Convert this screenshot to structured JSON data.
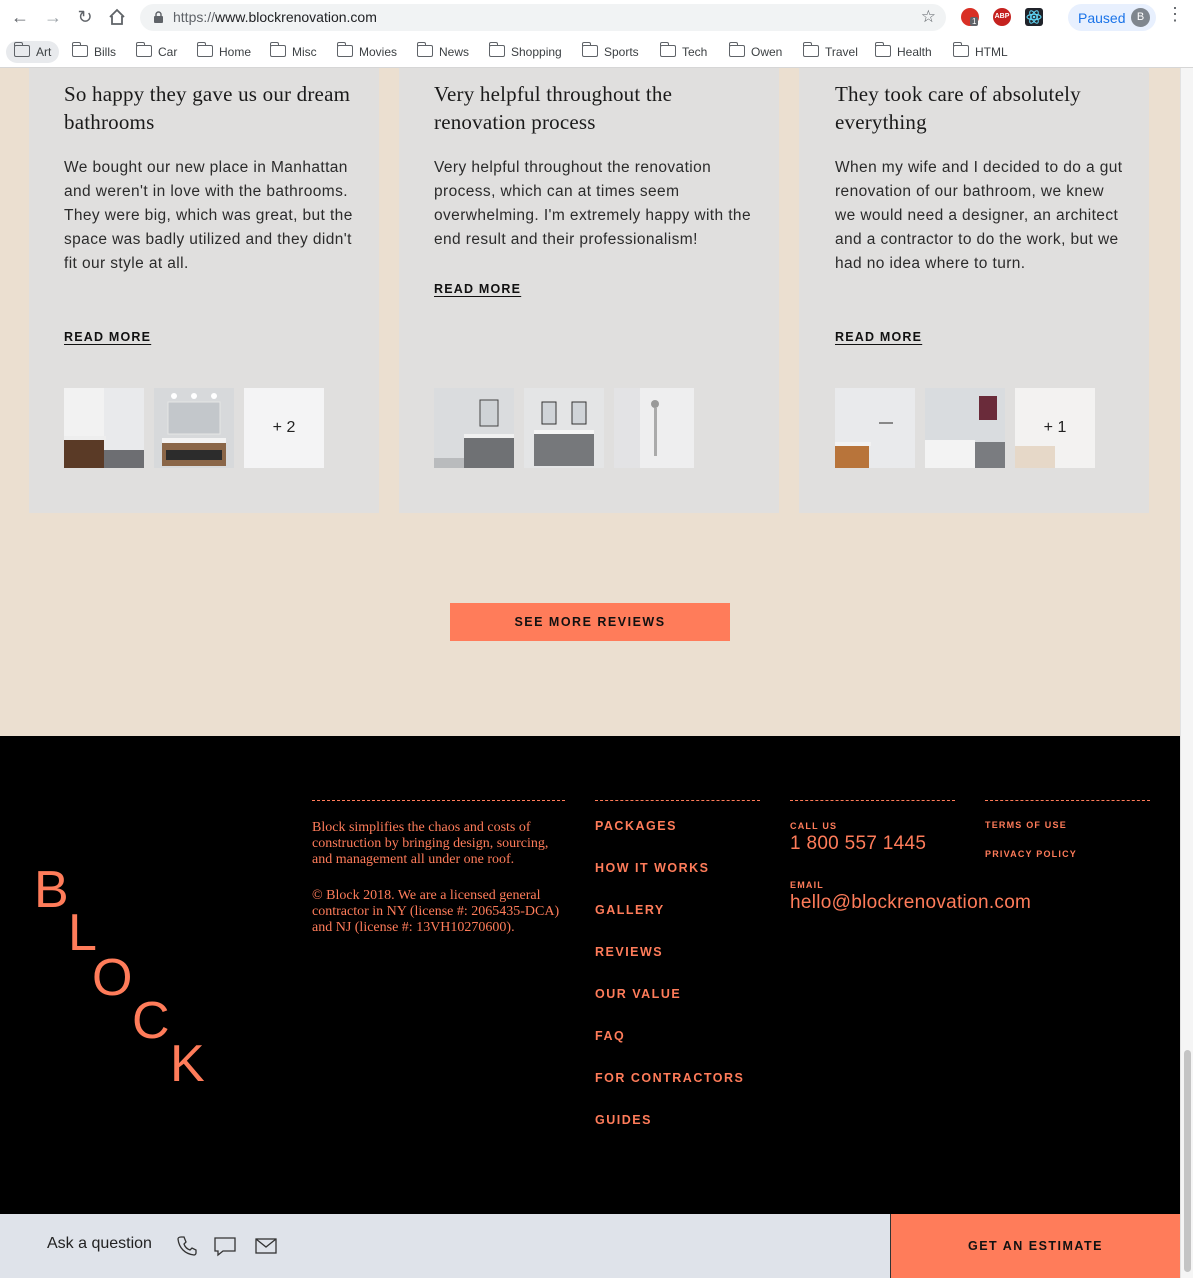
{
  "browser": {
    "url_protocol": "https://",
    "url_domain": "www.blockrenovation.com",
    "profile_status": "Paused",
    "profile_initial": "B",
    "extension_badge": "1",
    "abp_label": "ABP",
    "bookmarks": [
      "Art",
      "Bills",
      "Car",
      "Home",
      "Misc",
      "Movies",
      "News",
      "Shopping",
      "Sports",
      "Tech",
      "Owen",
      "Travel",
      "Health",
      "HTML"
    ]
  },
  "reviews": [
    {
      "title": "So happy they gave us our dream bathrooms",
      "body": "We bought our new place in Manhattan and weren't in love with the bathrooms. They were big, which was great, but the space was badly utilized and they didn't fit our style at all.",
      "read_more": "READ MORE",
      "extra_photos": "+ 2"
    },
    {
      "title": "Very helpful throughout the renovation process",
      "body": "Very helpful throughout the renovation process, which can at times seem overwhelming. I'm extremely happy with the end result and their professionalism!",
      "read_more": "READ MORE",
      "extra_photos": ""
    },
    {
      "title": "They took care of absolutely everything",
      "body": "When my wife and I decided to do a gut renovation of our bathroom, we knew we would need a designer, an architect and a contractor to do the work, but we had no idea where to turn.",
      "read_more": "READ MORE",
      "extra_photos": "+ 1"
    }
  ],
  "see_more_label": "SEE MORE REVIEWS",
  "footer": {
    "logo_letters": [
      "B",
      "L",
      "O",
      "C",
      "K"
    ],
    "about": "Block simplifies the chaos and costs of construction by bringing design, sourcing, and management all under one roof.",
    "legal": "© Block 2018. We are a licensed general contractor in NY (license #: 2065435-DCA) and NJ (license #: 13VH10270600).",
    "nav": [
      "PACKAGES",
      "HOW IT WORKS",
      "GALLERY",
      "REVIEWS",
      "OUR VALUE",
      "FAQ",
      "FOR CONTRACTORS",
      "GUIDES"
    ],
    "call_label": "CALL US",
    "phone": "1 800 557 1445",
    "email_label": "EMAIL",
    "email": "hello@blockrenovation.com",
    "terms": "TERMS OF USE",
    "privacy": "PRIVACY POLICY"
  },
  "bottom_bar": {
    "ask_label": "Ask a question",
    "estimate_label": "GET AN ESTIMATE"
  },
  "colors": {
    "accent": "#ff7c5a",
    "page_bg": "#ebdfd0",
    "card_bg": "#e0dfde",
    "footer_bg": "#000000",
    "bottom_bar_bg": "#dfe3ea"
  }
}
